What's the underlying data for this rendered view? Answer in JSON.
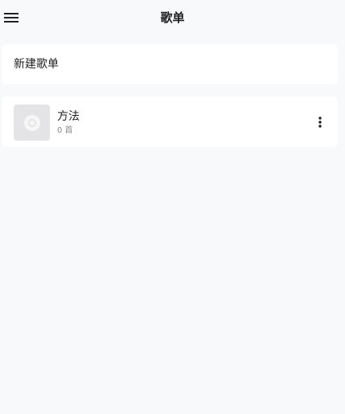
{
  "header": {
    "title": "歌单",
    "menu_icon": "hamburger-menu-icon"
  },
  "new_playlist": {
    "label": "新建歌单"
  },
  "playlists": [
    {
      "name": "方法",
      "count": "0 首",
      "cover_icon": "disc-icon",
      "more_icon": "more-vertical-icon"
    }
  ],
  "colors": {
    "background": "#f8f9fb",
    "card": "#ffffff",
    "cover_placeholder": "#e4e4e6",
    "secondary_text": "#8a8a8a"
  }
}
